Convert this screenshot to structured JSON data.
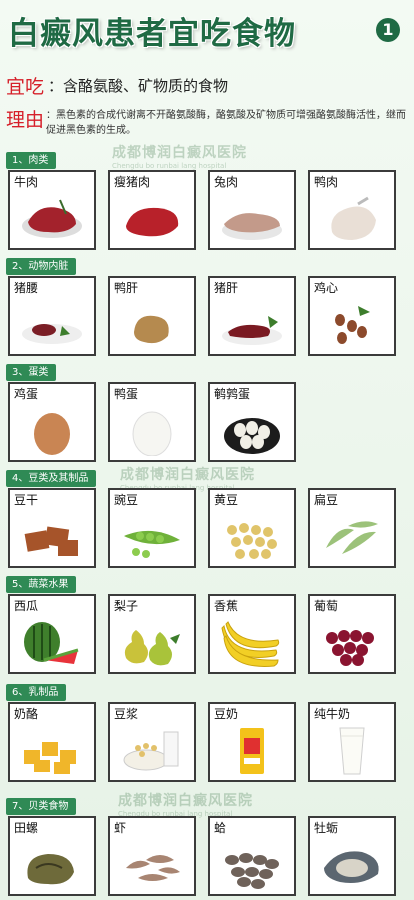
{
  "header": {
    "title": "白癜风患者宜吃食物",
    "badge": "1"
  },
  "intro": {
    "eat_label": "宜吃",
    "eat_text": "：含酪氨酸、矿物质的食物",
    "reason_label": "理由",
    "reason_text": "：黑色素的合成代谢离不开酪氨酸酶，酪氨酸及矿物质可增强酪氨酸酶活性，继而促进黑色素的生成。"
  },
  "watermark": {
    "text": "成都博润白癜风医院",
    "sub": "Chengdu bo runbai lang hospital"
  },
  "categories": [
    {
      "label": "1、肉类",
      "items": [
        "牛肉",
        "瘦猪肉",
        "兔肉",
        "鸭肉"
      ]
    },
    {
      "label": "2、动物内脏",
      "items": [
        "猪腰",
        "鸭肝",
        "猪肝",
        "鸡心"
      ]
    },
    {
      "label": "3、蛋类",
      "items": [
        "鸡蛋",
        "鸭蛋",
        "鹌鹑蛋"
      ]
    },
    {
      "label": "4、豆类及其制品",
      "items": [
        "豆干",
        "豌豆",
        "黄豆",
        "扁豆"
      ]
    },
    {
      "label": "5、蔬菜水果",
      "items": [
        "西瓜",
        "梨子",
        "香蕉",
        "葡萄"
      ]
    },
    {
      "label": "6、乳制品",
      "items": [
        "奶酪",
        "豆浆",
        "豆奶",
        "纯牛奶"
      ]
    },
    {
      "label": "7、贝类食物",
      "items": [
        "田螺",
        "虾",
        "蛤",
        "牡蛎"
      ]
    }
  ],
  "colors": {
    "title": "#1f6a44",
    "accent_red": "#d6202a",
    "category_bg": "#2f8a55"
  }
}
